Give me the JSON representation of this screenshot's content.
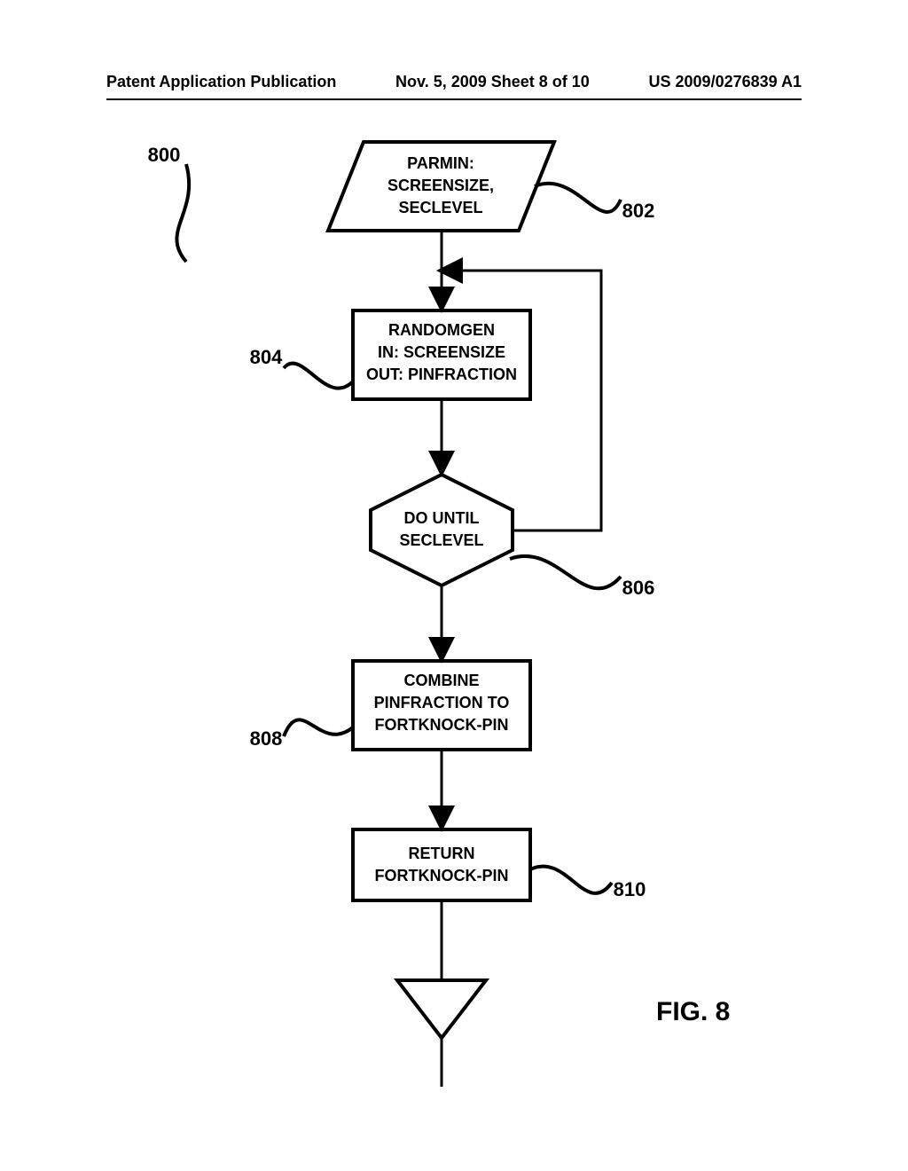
{
  "header": {
    "left": "Patent Application Publication",
    "center": "Nov. 5, 2009  Sheet 8 of 10",
    "right": "US 2009/0276839 A1"
  },
  "labels": {
    "l800": "800",
    "l802": "802",
    "l804": "804",
    "l806": "806",
    "l808": "808",
    "l810": "810"
  },
  "shapes": {
    "parmin": {
      "line1": "PARMIN:",
      "line2": "SCREENSIZE,",
      "line3": "SECLEVEL"
    },
    "randomgen": {
      "line1": "RANDOMGEN",
      "line2": "IN: SCREENSIZE",
      "line3": "OUT: PINFRACTION"
    },
    "dountil": {
      "line1": "DO UNTIL",
      "line2": "SECLEVEL"
    },
    "combine": {
      "line1": "COMBINE",
      "line2": "PINFRACTION TO",
      "line3": "FORTKNOCK-PIN"
    },
    "return": {
      "line1": "RETURN",
      "line2": "FORTKNOCK-PIN"
    }
  },
  "caption": "FIG. 8"
}
